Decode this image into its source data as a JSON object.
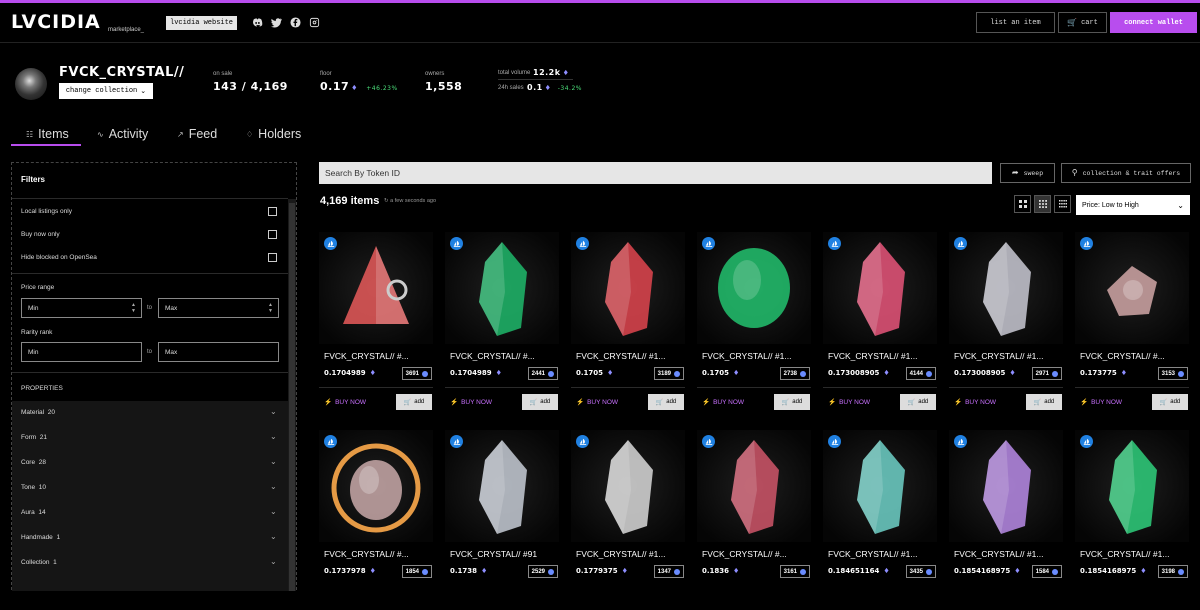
{
  "nav": {
    "logo": "LVCIDIA",
    "logo_sub": "marketplace_",
    "website_label": "lvcidia website",
    "social_icons": [
      "discord-icon",
      "twitter-icon",
      "facebook-icon",
      "instagram-icon"
    ],
    "list_label": "list an item",
    "cart_label": "cart",
    "connect_label": "connect wallet"
  },
  "collection": {
    "name": "FVCK_CRYSTAL//",
    "change_label": "change collection",
    "on_sale_label": "on sale",
    "on_sale_value": "143 / 4,169",
    "floor_label": "floor",
    "floor_value": "0.17",
    "floor_change": "+46.23%",
    "owners_label": "owners",
    "owners_value": "1,558",
    "volume_label": "total volume",
    "volume_value": "12.2k",
    "sales_label": "24h sales",
    "sales_value": "0.1",
    "sales_change": "-34.2%"
  },
  "tabs": [
    {
      "label": "Items",
      "icon": "items-icon"
    },
    {
      "label": "Activity",
      "icon": "activity-icon"
    },
    {
      "label": "Feed",
      "icon": "feed-icon"
    },
    {
      "label": "Holders",
      "icon": "holders-icon"
    }
  ],
  "filters": {
    "title": "Filters",
    "toggles": [
      "Local listings only",
      "Buy now only",
      "Hide blocked on OpenSea"
    ],
    "price_label": "Price range",
    "price_min": "Min",
    "price_max": "Max",
    "to_label": "to",
    "rarity_label": "Rarity rank",
    "rarity_min": "Min",
    "rarity_max": "Max",
    "properties_label": "PROPERTIES",
    "properties": [
      {
        "name": "Material",
        "count": "20"
      },
      {
        "name": "Form",
        "count": "21"
      },
      {
        "name": "Core",
        "count": "28"
      },
      {
        "name": "Tone",
        "count": "10"
      },
      {
        "name": "Aura",
        "count": "14"
      },
      {
        "name": "Handmade",
        "count": "1"
      },
      {
        "name": "Collection",
        "count": "1"
      }
    ]
  },
  "toolbar": {
    "search_placeholder": "Search By Token ID",
    "sweep_label": "sweep",
    "offers_label": "collection & trait offers",
    "items_count": "4,169 items",
    "updated": "a few seconds ago",
    "sort_value": "Price: Low to High"
  },
  "card_labels": {
    "buy": "BUY NOW",
    "add": "add"
  },
  "cards": [
    {
      "name": "FVCK_CRYSTAL// #...",
      "price": "0.1704989",
      "rank": "3691",
      "color": "#e85a5a",
      "shape": "pyramid"
    },
    {
      "name": "FVCK_CRYSTAL// #...",
      "price": "0.1704989",
      "rank": "2441",
      "color": "#1fb86b",
      "shape": "tall"
    },
    {
      "name": "FVCK_CRYSTAL// #1...",
      "price": "0.1705",
      "rank": "3189",
      "color": "#e0454f",
      "shape": "tall"
    },
    {
      "name": "FVCK_CRYSTAL// #1...",
      "price": "0.1705",
      "rank": "2738",
      "color": "#22c26f",
      "shape": "wide"
    },
    {
      "name": "FVCK_CRYSTAL// #1...",
      "price": "0.173008905",
      "rank": "4144",
      "color": "#e8557a",
      "shape": "tall"
    },
    {
      "name": "FVCK_CRYSTAL// #1...",
      "price": "0.173008905",
      "rank": "2971",
      "color": "#c9c9d4",
      "shape": "tall"
    },
    {
      "name": "FVCK_CRYSTAL// #...",
      "price": "0.173775",
      "rank": "3153",
      "color": "#d1a7a7",
      "shape": "small"
    },
    {
      "name": "FVCK_CRYSTAL// #...",
      "price": "0.1737978",
      "rank": "1854",
      "color": "#e59a45",
      "shape": "round"
    },
    {
      "name": "FVCK_CRYSTAL// #91",
      "price": "0.1738",
      "rank": "2529",
      "color": "#c7ccd6",
      "shape": "tall"
    },
    {
      "name": "FVCK_CRYSTAL// #1...",
      "price": "0.1779375",
      "rank": "1347",
      "color": "#d9d9d9",
      "shape": "tall"
    },
    {
      "name": "FVCK_CRYSTAL// #...",
      "price": "0.1836",
      "rank": "3161",
      "color": "#d0566a",
      "shape": "tall"
    },
    {
      "name": "FVCK_CRYSTAL// #1...",
      "price": "0.184651164",
      "rank": "3435",
      "color": "#6fd1c8",
      "shape": "tall"
    },
    {
      "name": "FVCK_CRYSTAL// #1...",
      "price": "0.1854168975",
      "rank": "1584",
      "color": "#b98be8",
      "shape": "tall"
    },
    {
      "name": "FVCK_CRYSTAL// #1...",
      "price": "0.1854168975",
      "rank": "3198",
      "color": "#2fd07c",
      "shape": "tall"
    }
  ],
  "colors": {
    "accent": "#b84dee",
    "positive": "#4bdf7a",
    "opensea": "#2081e2"
  }
}
